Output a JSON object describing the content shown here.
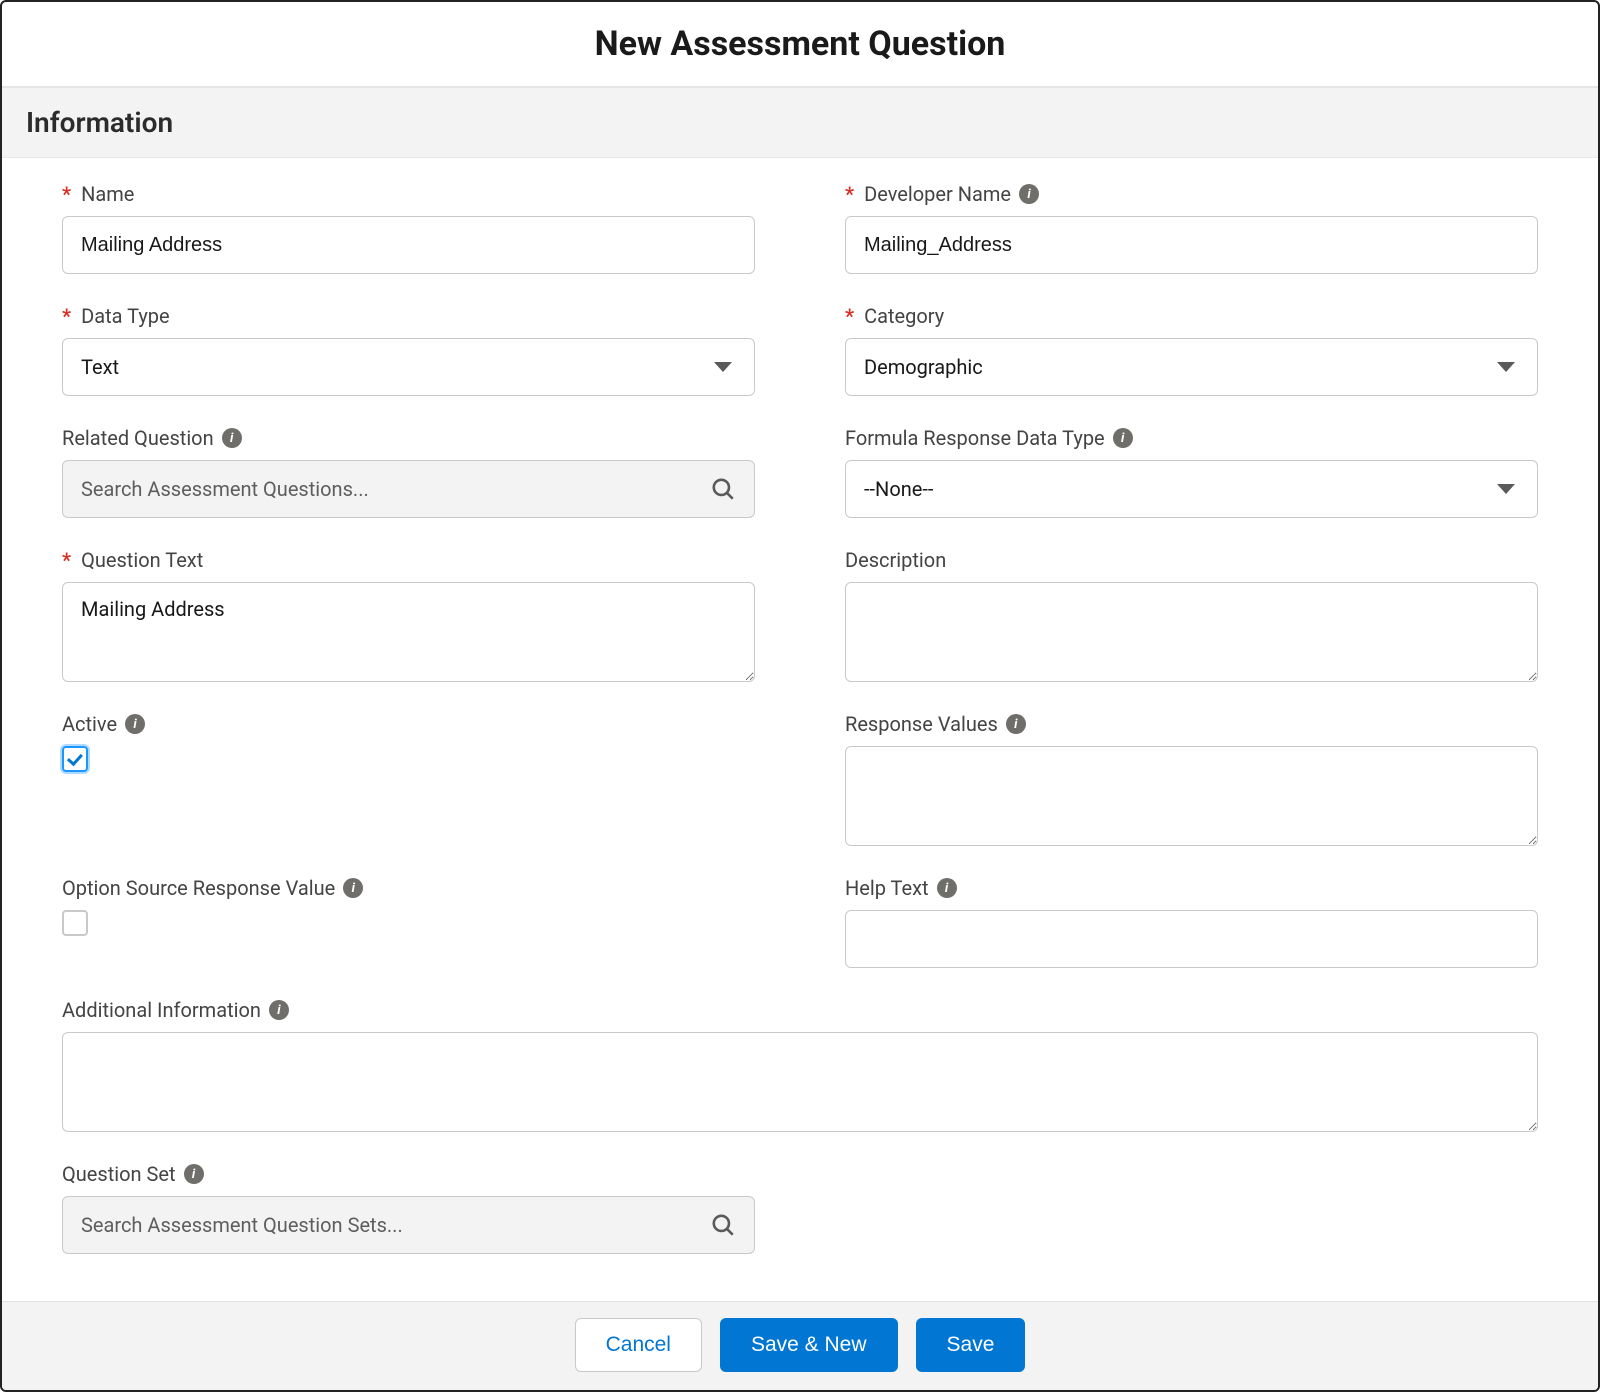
{
  "title": "New Assessment Question",
  "sectionHeader": "Information",
  "labels": {
    "name": "Name",
    "developerName": "Developer Name",
    "dataType": "Data Type",
    "category": "Category",
    "relatedQuestion": "Related Question",
    "formulaResponseDataType": "Formula Response Data Type",
    "questionText": "Question Text",
    "description": "Description",
    "active": "Active",
    "responseValues": "Response Values",
    "optionSourceResponseValue": "Option Source Response Value",
    "helpText": "Help Text",
    "additionalInformation": "Additional Information",
    "questionSet": "Question Set"
  },
  "values": {
    "name": "Mailing Address",
    "developerName": "Mailing_Address",
    "dataType": "Text",
    "category": "Demographic",
    "formulaResponseDataType": "--None--",
    "questionText": "Mailing Address",
    "description": "",
    "responseValues": "",
    "helpText": "",
    "additionalInformation": "",
    "activeChecked": true,
    "optionSourceChecked": false
  },
  "placeholders": {
    "relatedQuestion": "Search Assessment Questions...",
    "questionSet": "Search Assessment Question Sets..."
  },
  "buttons": {
    "cancel": "Cancel",
    "saveNew": "Save & New",
    "save": "Save"
  }
}
